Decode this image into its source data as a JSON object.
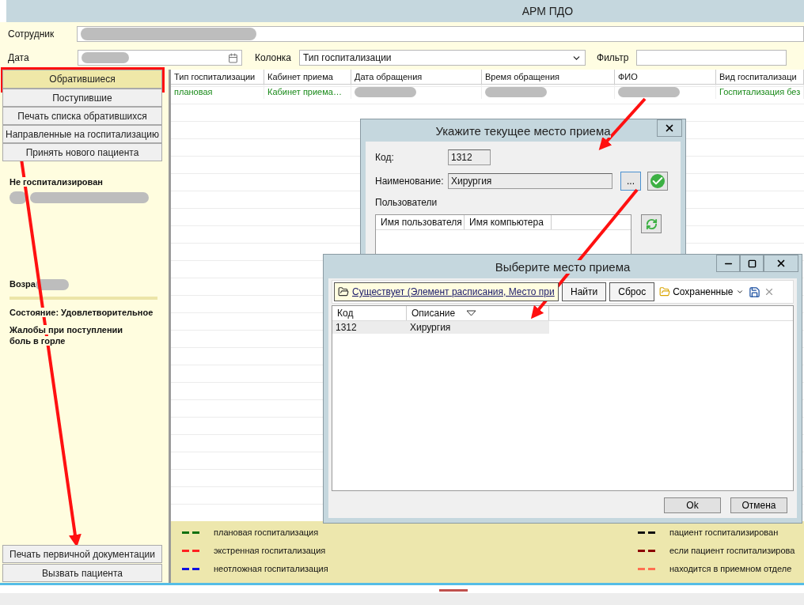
{
  "window": {
    "title": "АРМ ПДО"
  },
  "toolbar": {
    "employee_label": "Сотрудник",
    "date_label": "Дата",
    "column_label": "Колонка",
    "column_value": "Тип госпитализации",
    "filter_label": "Фильтр"
  },
  "sidebar": {
    "buttons": [
      {
        "label": "Обратившиеся",
        "selected": true
      },
      {
        "label": "Поступившие",
        "selected": false
      },
      {
        "label": "Печать списка обратившихся",
        "selected": false
      },
      {
        "label": "Направленные на госпитализацию",
        "selected": false
      },
      {
        "label": "Принять нового пациента",
        "selected": false
      }
    ],
    "status": "Не госпитализирован",
    "age_label": "Возра",
    "condition": "Состояние: Удовлетворительное",
    "complaints_title": "Жалобы при поступлении",
    "complaints": "боль в горле",
    "bottom_buttons": [
      {
        "label": "Печать первичной документации"
      },
      {
        "label": "Вызвать пациента"
      }
    ]
  },
  "table": {
    "columns": [
      "Тип госпитализации",
      "Кабинет приема",
      "Дата обращения",
      "Время обращения",
      "ФИО",
      "Вид госпитализаци"
    ],
    "rows": [
      {
        "color": "#1a8a1a",
        "cells": [
          {
            "text": "плановая"
          },
          {
            "text": "Кабинет приема…"
          },
          {
            "redacted": true
          },
          {
            "redacted": true
          },
          {
            "redacted": true
          },
          {
            "text": "Госпитализация без"
          }
        ]
      }
    ]
  },
  "legend": [
    {
      "color": "#107010",
      "label": "плановая госпитализация"
    },
    {
      "color": "#ff2020",
      "label": "экстренная госпитализация"
    },
    {
      "color": "#1010e0",
      "label": "неотложная госпитализация"
    },
    {
      "color": "#101010",
      "label": "пациент госпитализирован"
    },
    {
      "color": "#8b0000",
      "label": "если пациент госпитализирова"
    },
    {
      "color": "#ff7050",
      "label": "находится в приемном отделе"
    }
  ],
  "place_dialog": {
    "title": "Укажите текущее место приема",
    "code_label": "Код:",
    "code_value": "1312",
    "name_label": "Наименование:",
    "name_value": "Хирургия",
    "browse_button": "...",
    "users_group": "Пользователи",
    "users_columns": [
      "Имя пользователя",
      "Имя компьютера"
    ]
  },
  "select_dialog": {
    "title": "Выберите место приема",
    "filter_link": "Существует (Элемент расписания, Место при",
    "find_button": "Найти",
    "reset_button": "Сброс",
    "saved_menu": "Сохраненные",
    "columns": [
      "Код",
      "Описание"
    ],
    "rows": [
      {
        "cells": [
          "1312",
          "Хирургия"
        ],
        "selected": true
      }
    ],
    "ok_button": "Ok",
    "cancel_button": "Отмена"
  }
}
